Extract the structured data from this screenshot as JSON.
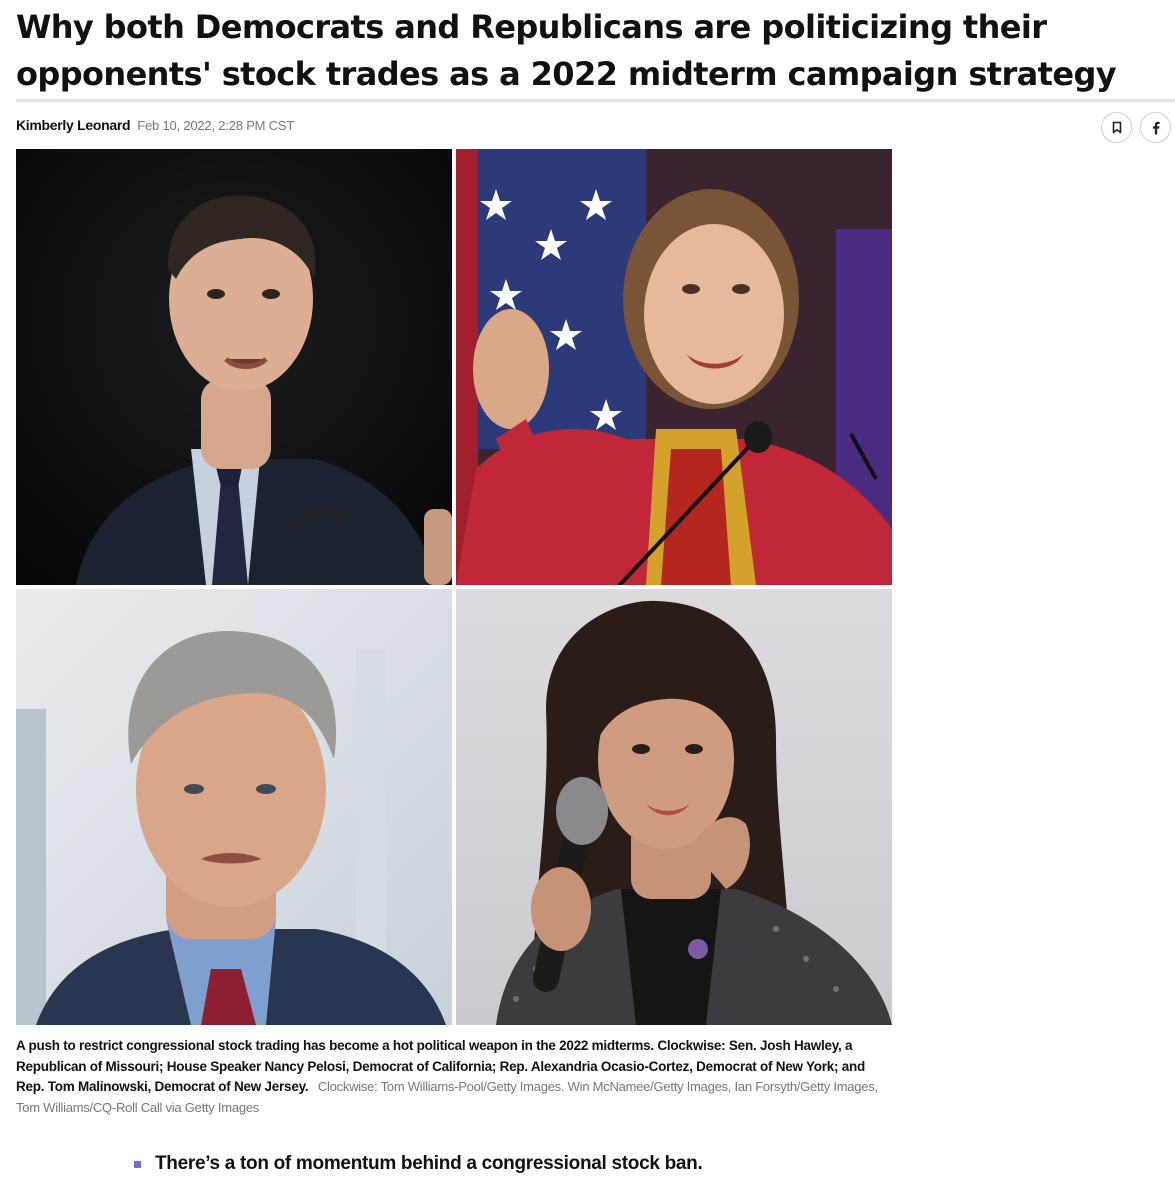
{
  "article": {
    "headline": "Why both Democrats and Republicans are politicizing their opponents' stock trades as a 2022 midterm campaign strategy",
    "author": "Kimberly Leonard",
    "date": "Feb 10, 2022, 2:28 PM CST"
  },
  "actions": {
    "bookmark_icon": "bookmark-icon",
    "facebook_icon": "facebook-icon"
  },
  "photos": [
    {
      "icon": "portrait-man-dark-suit"
    },
    {
      "icon": "portrait-woman-red-jacket-flag"
    },
    {
      "icon": "portrait-man-gray-hair"
    },
    {
      "icon": "portrait-woman-microphone"
    }
  ],
  "caption": {
    "text": "A push to restrict congressional stock trading has become a hot political weapon in the 2022 midterms. Clockwise: Sen. Josh Hawley, a Republican of Missouri; House Speaker Nancy Pelosi, Democrat of California; Rep. Alexandria Ocasio-Cortez, Democrat of New York; and Rep. Tom Malinowski, Democrat of New Jersey.",
    "credit": "Clockwise: Tom Williams-Pool/Getty Images. Win McNamee/Getty Images, Ian Forsyth/Getty Images, Tom Williams/CQ-Roll Call via Getty Images"
  },
  "bullets": [
    "There’s a ton of momentum behind a congressional stock ban."
  ],
  "colors": {
    "accent": "#6e6fd6",
    "rule": "#e3e3e3",
    "muted_text": "#777777"
  }
}
